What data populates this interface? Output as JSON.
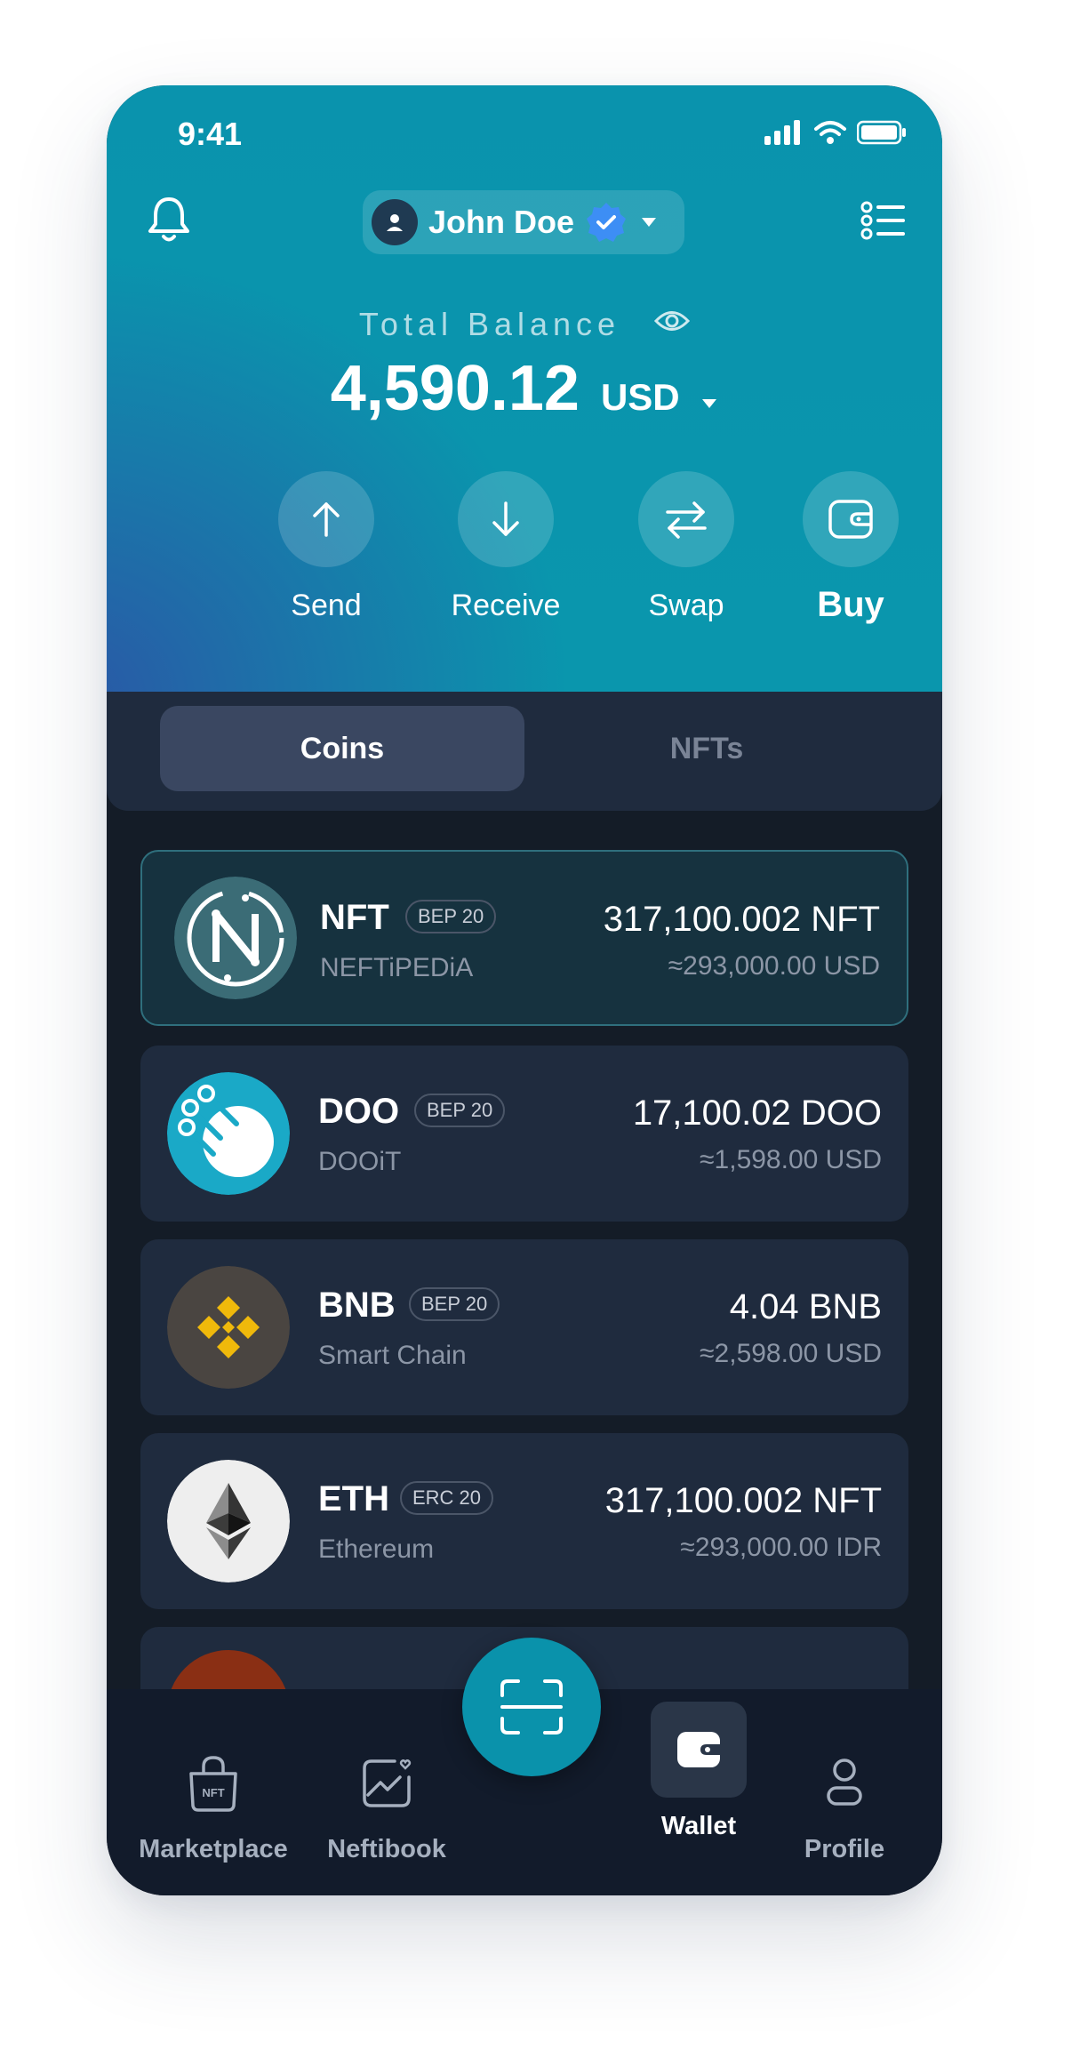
{
  "status_bar": {
    "time": "9:41"
  },
  "user": {
    "name": "John Doe"
  },
  "balance": {
    "label": "Total Balance",
    "amount": "4,590.12",
    "currency": "USD"
  },
  "actions": [
    {
      "label": "Send",
      "icon": "arrow-up-icon"
    },
    {
      "label": "Receive",
      "icon": "arrow-down-icon"
    },
    {
      "label": "Swap",
      "icon": "swap-icon"
    },
    {
      "label": "Buy",
      "icon": "wallet-icon"
    }
  ],
  "tabs": [
    {
      "label": "Coins",
      "active": true
    },
    {
      "label": "NFTs",
      "active": false
    }
  ],
  "coins": [
    {
      "symbol": "NFT",
      "badge": "BEP 20",
      "name": "NEFTiPEDiA",
      "amount": "317,100.002 NFT",
      "value": "≈293,000.00 USD",
      "selected": true,
      "logo": "neftipedia-logo-icon"
    },
    {
      "symbol": "DOO",
      "badge": "BEP 20",
      "name": "DOOiT",
      "amount": "17,100.02 DOO",
      "value": "≈1,598.00 USD",
      "selected": false,
      "logo": "dooit-logo-icon"
    },
    {
      "symbol": "BNB",
      "badge": "BEP 20",
      "name": "Smart Chain",
      "amount": "4.04 BNB",
      "value": "≈2,598.00 USD",
      "selected": false,
      "logo": "bnb-logo-icon"
    },
    {
      "symbol": "ETH",
      "badge": "ERC 20",
      "name": "Ethereum",
      "amount": "317,100.002 NFT",
      "value": "≈293,000.00 IDR",
      "selected": false,
      "logo": "ethereum-logo-icon"
    }
  ],
  "nav": [
    {
      "label": "Marketplace",
      "icon": "marketplace-bag-icon",
      "icon_text": "NFT"
    },
    {
      "label": "Neftibook",
      "icon": "neftibook-chart-icon"
    },
    {
      "label": "Wallet",
      "icon": "wallet-icon",
      "active": true
    },
    {
      "label": "Profile",
      "icon": "profile-icon"
    }
  ],
  "colors": {
    "accent": "#0a92ab",
    "background": "#141c27",
    "card": "#1f2b3e"
  }
}
